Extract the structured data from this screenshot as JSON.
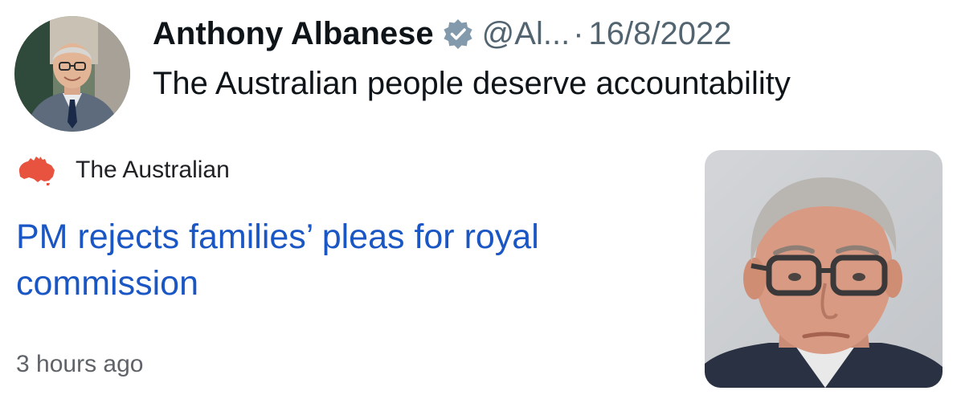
{
  "tweet": {
    "author_name": "Anthony Albanese",
    "verified_icon": "verified-badge-icon",
    "handle": "@Al...",
    "separator": "·",
    "date": "16/8/2022",
    "text": "The Australian people deserve accountability"
  },
  "news_card": {
    "source_logo_icon": "australia-map-icon",
    "source_name": "The Australian",
    "headline": "PM rejects families’ pleas for royal commission",
    "timestamp": "3 hours ago",
    "thumbnail": "portrait-photo"
  },
  "colors": {
    "headline_link": "#1a56c4",
    "verified_badge": "#829aab",
    "source_logo": "#e8533f",
    "secondary_text": "#536471"
  }
}
